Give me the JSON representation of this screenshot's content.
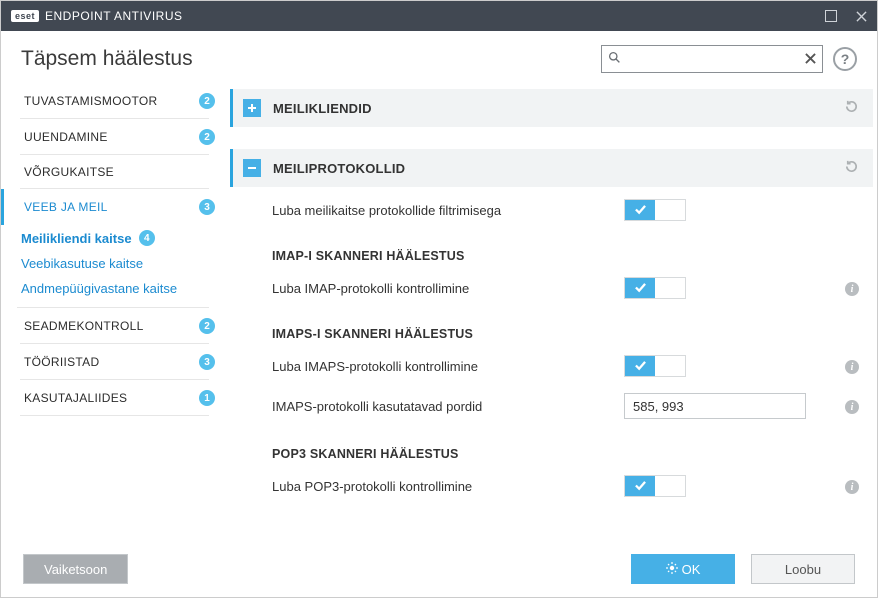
{
  "titlebar": {
    "brand_badge": "eset",
    "product": "ENDPOINT ANTIVIRUS"
  },
  "header": {
    "title": "Täpsem häälestus",
    "search_placeholder": "",
    "help": "?"
  },
  "sidebar": {
    "items": [
      {
        "label": "TUVASTAMISMOOTOR",
        "badge": "2"
      },
      {
        "label": "UUENDAMINE",
        "badge": "2"
      },
      {
        "label": "VÕRGUKAITSE",
        "badge": ""
      },
      {
        "label": "VEEB JA MEIL",
        "badge": "3"
      },
      {
        "label": "SEADMEKONTROLL",
        "badge": "2"
      },
      {
        "label": "TÖÖRIISTAD",
        "badge": "3"
      },
      {
        "label": "KASUTAJALIIDES",
        "badge": "1"
      }
    ],
    "subs": [
      {
        "label": "Meilikliendi kaitse",
        "badge": "4"
      },
      {
        "label": "Veebikasutuse kaitse"
      },
      {
        "label": "Andmepüügivastane kaitse"
      }
    ]
  },
  "sections": {
    "mailclients": {
      "title": "MEILIKLIENDID"
    },
    "mailprotocols": {
      "title": "MEILIPROTOKOLLID",
      "enable_filter": "Luba meilikaitse protokollide filtrimisega",
      "imap_hdr": "IMAP-I SKANNERI HÄÄLESTUS",
      "imap_enable": "Luba IMAP-protokolli kontrollimine",
      "imaps_hdr": "IMAPS-I SKANNERI HÄÄLESTUS",
      "imaps_enable": "Luba IMAPS-protokolli kontrollimine",
      "imaps_ports_label": "IMAPS-protokolli kasutatavad pordid",
      "imaps_ports_value": "585, 993",
      "pop3_hdr": "POP3 SKANNERI HÄÄLESTUS",
      "pop3_enable": "Luba POP3-protokolli kontrollimine"
    }
  },
  "footer": {
    "defaults": "Vaiketsoon",
    "ok": "OK",
    "cancel": "Loobu"
  }
}
